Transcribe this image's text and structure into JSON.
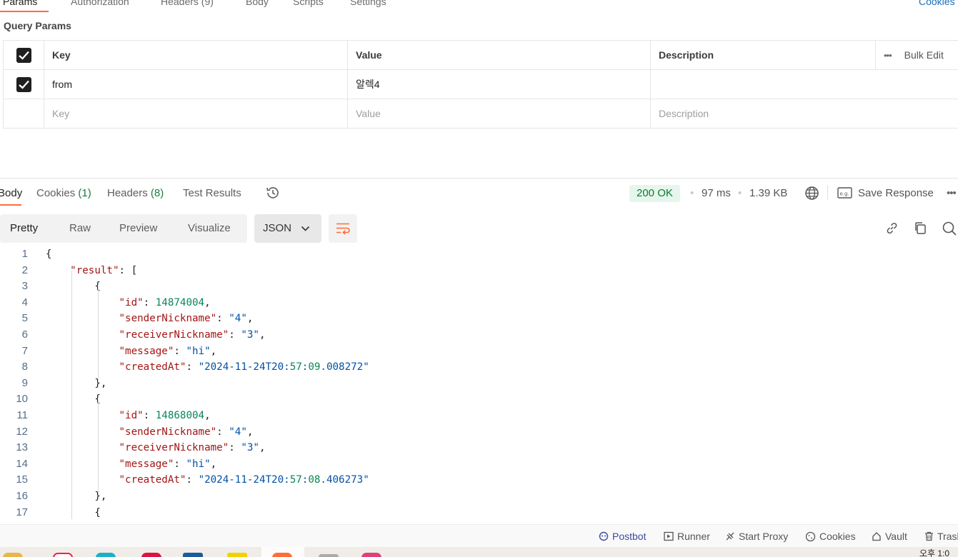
{
  "request_tabs": [
    "Params",
    "Authorization",
    "Headers (9)",
    "Body",
    "Scripts",
    "Settings"
  ],
  "cookies_link": "Cookies",
  "query_params": {
    "title": "Query Params",
    "columns": {
      "key": "Key",
      "value": "Value",
      "description": "Description"
    },
    "bulk_edit": "Bulk Edit",
    "rows": [
      {
        "checked": true,
        "key": "from",
        "value": "알렉4",
        "description": ""
      }
    ],
    "placeholder": {
      "key": "Key",
      "value": "Value",
      "description": "Description"
    }
  },
  "response": {
    "tabs": {
      "body": "Body",
      "cookies": "Cookies",
      "cookies_count": "(1)",
      "headers": "Headers",
      "headers_count": "(8)",
      "test_results": "Test Results"
    },
    "status": "200 OK",
    "time": "97 ms",
    "size": "1.39 KB",
    "save_response": "Save Response",
    "view_modes": [
      "Pretty",
      "Raw",
      "Preview",
      "Visualize"
    ],
    "format": "JSON",
    "code_lines": [
      {
        "n": "1",
        "text": "{"
      },
      {
        "n": "2",
        "text": "    \"result\": ["
      },
      {
        "n": "3",
        "text": "        {"
      },
      {
        "n": "4",
        "text": "            \"id\": 14874004,"
      },
      {
        "n": "5",
        "text": "            \"senderNickname\": \"4\","
      },
      {
        "n": "6",
        "text": "            \"receiverNickname\": \"3\","
      },
      {
        "n": "7",
        "text": "            \"message\": \"hi\","
      },
      {
        "n": "8",
        "text": "            \"createdAt\": \"2024-11-24T20:57:09.008272\""
      },
      {
        "n": "9",
        "text": "        },"
      },
      {
        "n": "10",
        "text": "        {"
      },
      {
        "n": "11",
        "text": "            \"id\": 14868004,"
      },
      {
        "n": "12",
        "text": "            \"senderNickname\": \"4\","
      },
      {
        "n": "13",
        "text": "            \"receiverNickname\": \"3\","
      },
      {
        "n": "14",
        "text": "            \"message\": \"hi\","
      },
      {
        "n": "15",
        "text": "            \"createdAt\": \"2024-11-24T20:57:08.406273\""
      },
      {
        "n": "16",
        "text": "        },"
      },
      {
        "n": "17",
        "text": "        {"
      }
    ]
  },
  "footer": {
    "postbot": "Postbot",
    "runner": "Runner",
    "start_proxy": "Start Proxy",
    "cookies": "Cookies",
    "vault": "Vault",
    "trash": "Trash"
  },
  "taskbar": {
    "clock": "오후 1:0"
  },
  "colors": {
    "accent": "#ff6c37",
    "status_ok": "#0b7a35",
    "json_key": "#a31515",
    "json_string": "#0451a5",
    "json_number": "#098658"
  }
}
